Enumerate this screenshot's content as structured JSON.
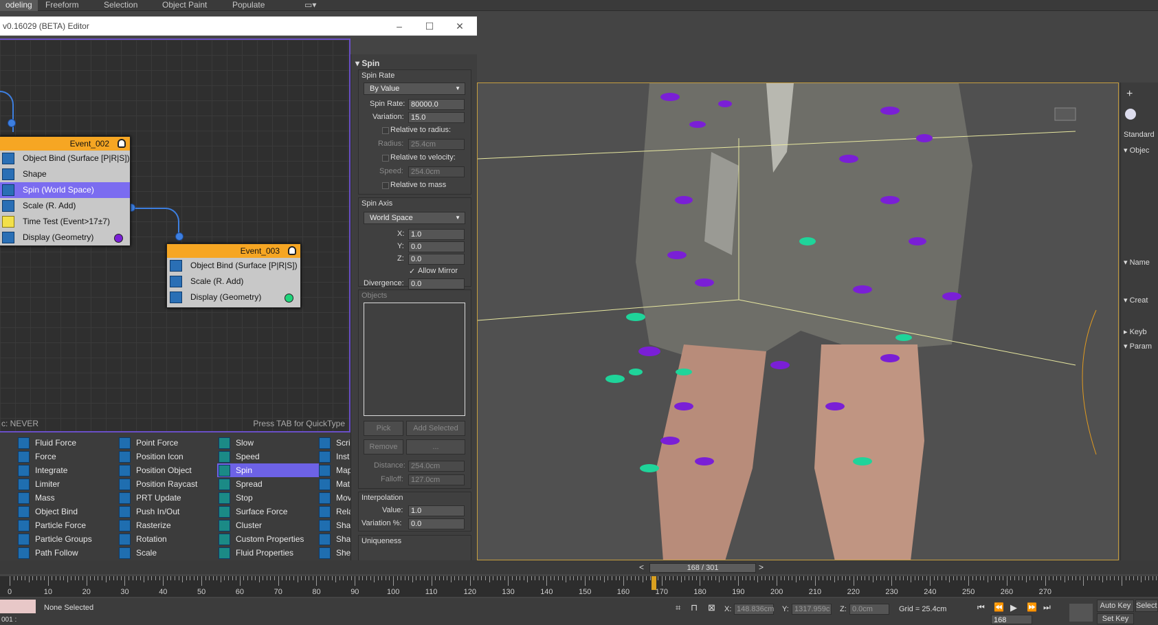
{
  "ribbon": {
    "tabs": [
      "odeling",
      "Freeform",
      "Selection",
      "Object Paint",
      "Populate"
    ]
  },
  "editor": {
    "title": "v0.16029 (BETA) Editor",
    "canvas_left_text": "c: NEVER",
    "canvas_hint": "Press TAB for QuickType"
  },
  "event2": {
    "name": "Event_002",
    "ops": [
      "Object Bind (Surface [P|R|S])",
      "Shape",
      "Spin (World Space)",
      "Scale (R. Add)",
      "Time Test (Event>17±7)",
      "Display (Geometry)"
    ]
  },
  "event3": {
    "name": "Event_003",
    "ops": [
      "Object Bind (Surface [P|R|S])",
      "Scale (R. Add)",
      "Display (Geometry)"
    ]
  },
  "depot": {
    "col1": [
      "Fluid Force",
      "Force",
      "Integrate",
      "Limiter",
      "Mass",
      "Object Bind",
      "Particle Force",
      "Particle Groups",
      "Path Follow"
    ],
    "col2": [
      "Point Force",
      "Position Icon",
      "Position Object",
      "Position Raycast",
      "PRT Update",
      "Push In/Out",
      "Rasterize",
      "Rotation",
      "Scale"
    ],
    "col3": [
      "Slow",
      "Speed",
      "Spin",
      "Spread",
      "Stop",
      "Surface Force",
      "Cluster",
      "Custom Properties",
      "Fluid Properties"
    ],
    "col4": [
      "Scri",
      "Inst",
      "Map",
      "Mat",
      "Mov",
      "Rela",
      "Sha",
      "Sha",
      "She"
    ]
  },
  "param": {
    "header": "Spin",
    "spin_rate_group": "Spin Rate",
    "spin_rate_mode": "By Value",
    "spin_rate_label": "Spin Rate:",
    "spin_rate_value": "80000.0",
    "variation_label": "Variation:",
    "variation_value": "15.0",
    "rel_radius": "Relative to radius:",
    "radius_label": "Radius:",
    "radius_value": "25.4cm",
    "rel_velocity": "Relative to velocity:",
    "speed_label": "Speed:",
    "speed_value": "254.0cm",
    "rel_mass": "Relative to mass",
    "axis_group": "Spin Axis",
    "axis_mode": "World Space",
    "x_label": "X:",
    "x_value": "1.0",
    "y_label": "Y:",
    "y_value": "0.0",
    "z_label": "Z:",
    "z_value": "0.0",
    "allow_mirror": "Allow Mirror",
    "divergence_label": "Divergence:",
    "divergence_value": "0.0",
    "objects_group": "Objects",
    "pick": "Pick",
    "add_selected": "Add Selected",
    "remove": "Remove",
    "ellipsis": "...",
    "distance_label": "Distance:",
    "distance_value": "254.0cm",
    "falloff_label": "Falloff:",
    "falloff_value": "127.0cm",
    "interp_group": "Interpolation",
    "value_label": "Value:",
    "value_value": "1.0",
    "variation_pct_label": "Variation %:",
    "variation_pct_value": "0.0",
    "uniqueness_group": "Uniqueness"
  },
  "cmd": {
    "standard": "Standard",
    "objec": "Objec",
    "name": "Name",
    "creat": "Creat",
    "keyb": "Keyb",
    "param": "Param"
  },
  "timeline": {
    "frame": "168 / 301",
    "ticks": [
      "0",
      "10",
      "20",
      "30",
      "40",
      "50",
      "60",
      "70",
      "80",
      "90",
      "100",
      "110",
      "120",
      "130",
      "140",
      "150",
      "160",
      "170",
      "180",
      "190",
      "200",
      "210",
      "220",
      "230",
      "240",
      "250",
      "260",
      "270"
    ]
  },
  "status": {
    "selection": "None Selected",
    "x_label": "X:",
    "x_value": "148.836cm",
    "y_label": "Y:",
    "y_value": "1317.959c",
    "z_label": "Z:",
    "z_value": "0.0cm",
    "grid": "Grid = 25.4cm",
    "auto_key": "Auto Key",
    "select": "Selecte",
    "set_key": "Set Key",
    "frame_field": "168",
    "left_field": "001 :"
  },
  "colors": {
    "accent": "#6d62e6",
    "event": "#f6a623",
    "wire": "#3d7fe0",
    "purple_leaf": "#7a1fd6",
    "green_leaf": "#1fd49a"
  }
}
